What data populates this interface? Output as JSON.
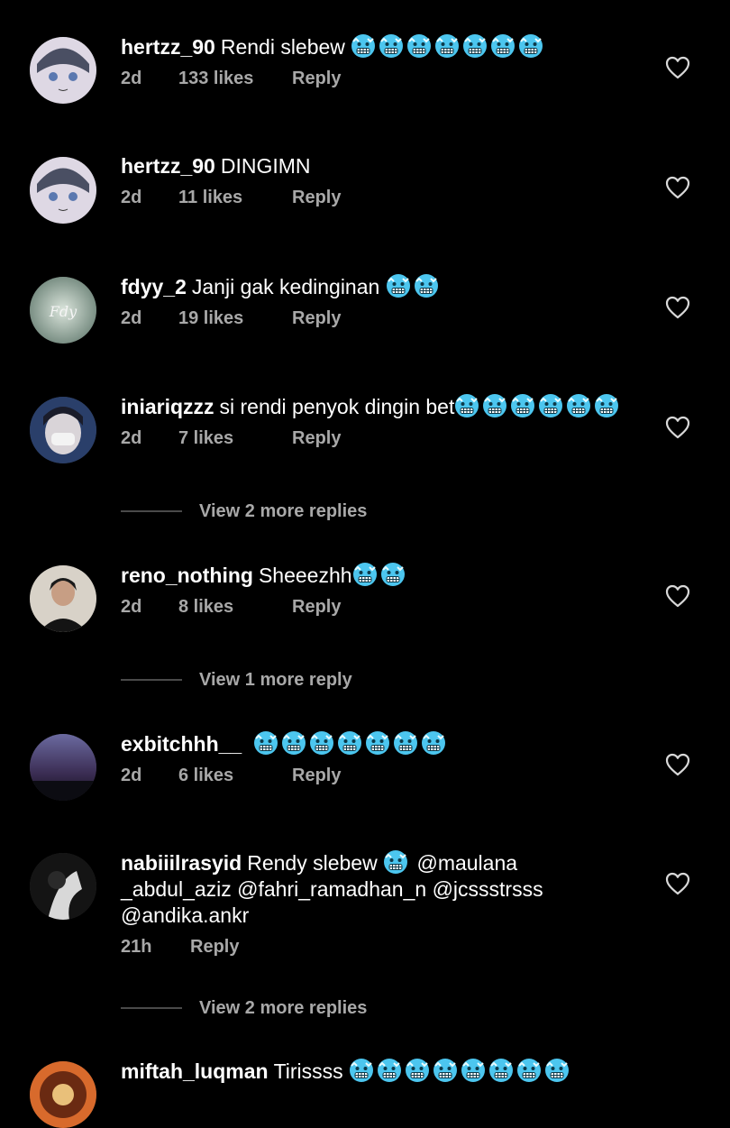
{
  "comments": [
    {
      "user": "hertzz_90",
      "text": "Rendi slebew ",
      "emoji_count": 7,
      "time": "2d",
      "likes": "133 likes",
      "reply": "Reply"
    },
    {
      "user": "hertzz_90",
      "text": "DINGIMN",
      "emoji_count": 0,
      "time": "2d",
      "likes": "11 likes",
      "reply": "Reply"
    },
    {
      "user": "fdyy_2",
      "text": "Janji gak kedinginan ",
      "emoji_count": 2,
      "time": "2d",
      "likes": "19 likes",
      "reply": "Reply"
    },
    {
      "user": "iniariqzzz",
      "text": "si rendi penyok dingin bet",
      "emoji_count": 6,
      "time": "2d",
      "likes": "7 likes",
      "reply": "Reply"
    },
    {
      "user": "reno_nothing",
      "text": "Sheeezhh",
      "emoji_count": 2,
      "time": "2d",
      "likes": "8 likes",
      "reply": "Reply"
    },
    {
      "user": "exbitchhh__",
      "text": " ",
      "emoji_count": 7,
      "time": "2d",
      "likes": "6 likes",
      "reply": "Reply"
    },
    {
      "user": "nabiiilrasyid",
      "text_line1": "Rendy slebew ",
      "mention1": "@maulana",
      "text_line2": "_abdul_aziz @fahri_ramadhan_n @jcssstrsss",
      "text_line3": "@andika.ankr",
      "emoji_count": 1,
      "time": "21h",
      "reply": "Reply"
    },
    {
      "user": "miftah_luqman",
      "text": "Tirissss ",
      "emoji_count": 8
    }
  ],
  "view_more": [
    "View 2 more replies",
    "View 1 more reply",
    "View 2 more replies"
  ],
  "icons": {
    "emoji": "cold-face-emoji",
    "like": "heart-outline-icon"
  },
  "colors": {
    "background": "#000000",
    "text": "#ffffff",
    "meta": "#a8a8a8",
    "emoji": "#4cc6ef"
  }
}
